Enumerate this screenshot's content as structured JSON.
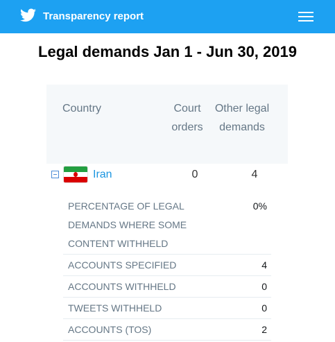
{
  "header": {
    "title": "Transparency report",
    "logo_icon": "twitter-bird-icon",
    "menu_icon": "hamburger-menu-icon",
    "bg_color": "#1da1f2"
  },
  "page": {
    "heading": "Legal demands Jan 1 - Jun 30, 2019"
  },
  "table": {
    "headers": {
      "country": "Country",
      "court_orders": "Court orders",
      "other_legal_demands": "Other legal demands"
    },
    "rows": [
      {
        "country": "Iran",
        "court_orders": "0",
        "other_legal_demands": "4",
        "flag_icon": "iran-flag-icon",
        "expanded": true
      }
    ],
    "details": [
      {
        "label": "PERCENTAGE OF LEGAL DEMANDS WHERE SOME CONTENT WITHHELD",
        "value": "0%"
      },
      {
        "label": "ACCOUNTS SPECIFIED",
        "value": "4"
      },
      {
        "label": "ACCOUNTS WITHHELD",
        "value": "0"
      },
      {
        "label": "TWEETS WITHHELD",
        "value": "0"
      },
      {
        "label": "ACCOUNTS (TOS)",
        "value": "2"
      }
    ]
  }
}
